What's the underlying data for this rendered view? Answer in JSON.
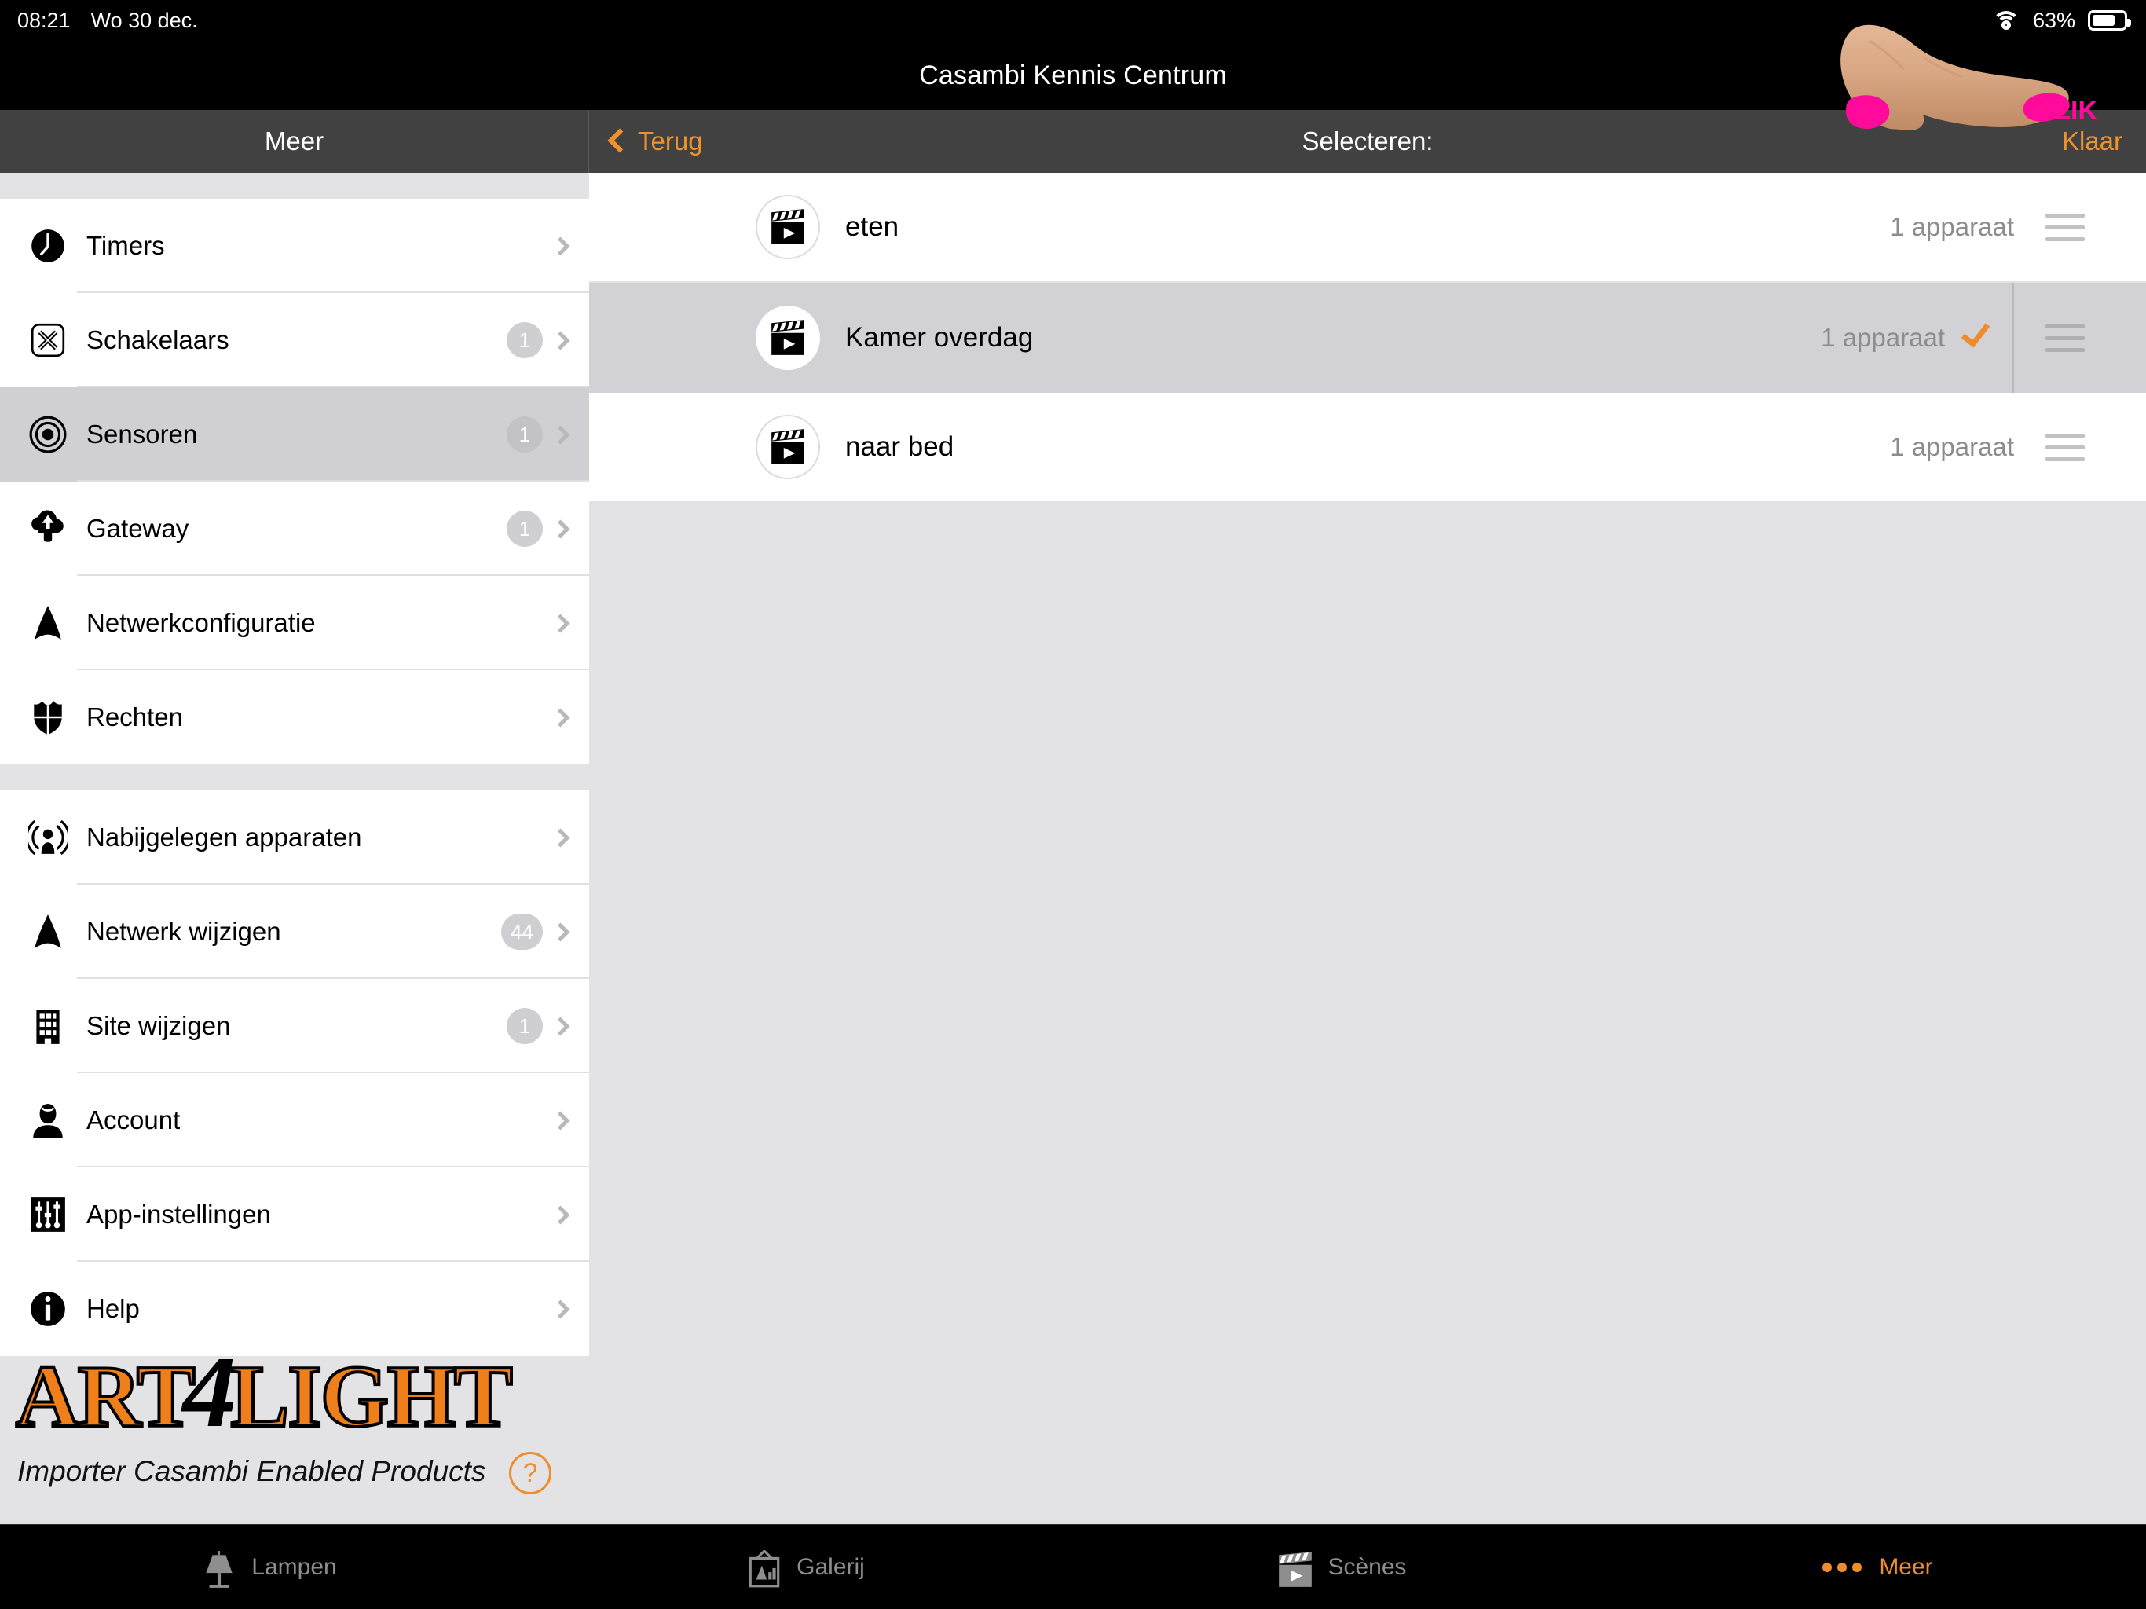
{
  "statusbar": {
    "time": "08:21",
    "date": "Wo 30 dec.",
    "battery_percent": "63%",
    "wifi_icon": "wifi-icon",
    "battery_icon": "battery-icon"
  },
  "app": {
    "title": "Casambi Kennis Centrum"
  },
  "left_nav": {
    "title": "Meer"
  },
  "right_nav": {
    "back_label": "Terug",
    "title": "Selecteren:",
    "done_label": "Klaar"
  },
  "overlay": {
    "klik_label": "KLIK",
    "klik_color": "#ff0a9b",
    "finger_icon": "pointing-finger-image"
  },
  "sidebar": {
    "groups": [
      {
        "items": [
          {
            "label": "Timers",
            "icon": "clock-icon",
            "badge": "",
            "selected": false
          },
          {
            "label": "Schakelaars",
            "icon": "switch-icon",
            "badge": "1",
            "selected": false
          },
          {
            "label": "Sensoren",
            "icon": "sensor-icon",
            "badge": "1",
            "selected": true
          },
          {
            "label": "Gateway",
            "icon": "gateway-cloud-icon",
            "badge": "1",
            "selected": false
          },
          {
            "label": "Netwerkconfiguratie",
            "icon": "network-icon",
            "badge": "",
            "selected": false
          },
          {
            "label": "Rechten",
            "icon": "shield-icon",
            "badge": "",
            "selected": false
          }
        ]
      },
      {
        "items": [
          {
            "label": "Nabijgelegen apparaten",
            "icon": "nearby-devices-icon",
            "badge": "",
            "selected": false
          },
          {
            "label": "Netwerk wijzigen",
            "icon": "network-icon",
            "badge": "44",
            "selected": false
          },
          {
            "label": "Site wijzigen",
            "icon": "building-icon",
            "badge": "1",
            "selected": false
          },
          {
            "label": "Account",
            "icon": "person-icon",
            "badge": "",
            "selected": false
          },
          {
            "label": "App-instellingen",
            "icon": "sliders-icon",
            "badge": "",
            "selected": false
          },
          {
            "label": "Help",
            "icon": "info-icon",
            "badge": "",
            "selected": false
          }
        ]
      }
    ]
  },
  "brand": {
    "part1": "ART",
    "part2": "4",
    "part3": "LIGHT",
    "tagline": "Importer Casambi Enabled Products",
    "help_glyph": "?",
    "accent": "#ef7f1a"
  },
  "main": {
    "rows": [
      {
        "name": "eten",
        "icon": "scene-clapperboard-icon",
        "devices": "1 apparaat",
        "selected": false
      },
      {
        "name": "Kamer overdag",
        "icon": "scene-clapperboard-icon",
        "devices": "1 apparaat",
        "selected": true
      },
      {
        "name": "naar bed",
        "icon": "scene-clapperboard-icon",
        "devices": "1 apparaat",
        "selected": false
      }
    ]
  },
  "tabbar": {
    "tabs": [
      {
        "label": "Lampen",
        "icon": "lamp-icon",
        "active": false
      },
      {
        "label": "Galerij",
        "icon": "gallery-icon",
        "active": false
      },
      {
        "label": "Scènes",
        "icon": "scene-clapperboard-icon",
        "active": false
      },
      {
        "label": "Meer",
        "icon": "ellipsis-icon",
        "active": true
      }
    ]
  },
  "colors": {
    "accent": "#ef8c2b",
    "navbar_bg": "#414141",
    "selected_row": "#d2d2d6"
  }
}
